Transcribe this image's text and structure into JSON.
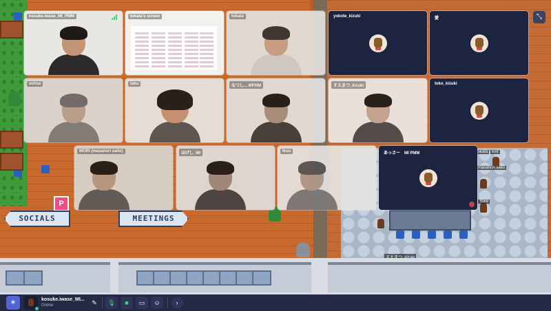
{
  "map": {
    "signs": {
      "socials": "SOCIALS",
      "meetings": "MEETINGS"
    },
    "pink_icon": "P",
    "labels": [
      "kotaro_kizuki",
      "すえまつ_kizuki",
      "Yone",
      "tokata",
      "kntr",
      "masanori saito"
    ]
  },
  "tiles": [
    {
      "name": "kosuke.iwase_MI_PMM",
      "type": "camera"
    },
    {
      "name": "tokata's screen",
      "type": "screen"
    },
    {
      "name": "tokata",
      "type": "camera"
    },
    {
      "name": "yokote_kizuki",
      "type": "avatar"
    },
    {
      "name": "愛",
      "type": "avatar"
    },
    {
      "name": "ochiai",
      "type": "camera"
    },
    {
      "name": "taku",
      "type": "camera"
    },
    {
      "name": "なつし... MPHM",
      "type": "camera"
    },
    {
      "name": "すえまつ_kizuki",
      "type": "camera"
    },
    {
      "name": "toko_kizuki",
      "type": "avatar"
    },
    {
      "name": "MORI (masanori saito)",
      "type": "camera"
    },
    {
      "name": "ほげし_MI",
      "type": "camera"
    },
    {
      "name": "Ikuu",
      "type": "camera"
    },
    {
      "name": "あっさー　MI PMM",
      "type": "avatar"
    }
  ],
  "bottom_bar": {
    "user_name": "kosuke.iwase_MI...",
    "status": "Online",
    "icons": [
      "gather-logo-icon",
      "pencil-icon",
      "mic-icon",
      "camera-icon",
      "screen-share-icon",
      "emoji-icon",
      "chevron-right-icon"
    ]
  },
  "colors": {
    "accent": "#5265d8",
    "bar": "#242944",
    "tile_dark": "#1c2440",
    "online": "#3ed07f"
  }
}
